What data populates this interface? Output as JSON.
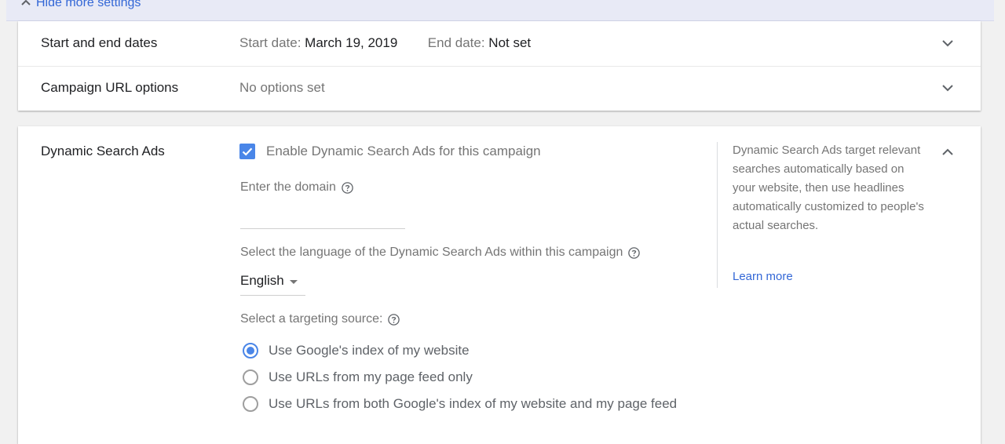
{
  "top_bar": {
    "hide_label": "Hide more settings"
  },
  "settings_rows": [
    {
      "title": "Start and end dates",
      "start_label": "Start date:",
      "start_value": "March 19, 2019",
      "end_label": "End date:",
      "end_value": "Not set"
    },
    {
      "title": "Campaign URL options",
      "summary": "No options set"
    }
  ],
  "dsa": {
    "title": "Dynamic Search Ads",
    "enable_label": "Enable Dynamic Search Ads for this campaign",
    "enable_checked": true,
    "domain_label": "Enter the domain",
    "domain_value": "",
    "language_label": "Select the language of the Dynamic Search Ads within this campaign",
    "language_value": "English",
    "targeting_label": "Select a targeting source:",
    "targeting_options": [
      {
        "label": "Use Google's index of my website",
        "selected": true
      },
      {
        "label": "Use URLs from my page feed only",
        "selected": false
      },
      {
        "label": "Use URLs from both Google's index of my website and my page feed",
        "selected": false
      }
    ],
    "side_text": "Dynamic Search Ads target relevant searches automatically based on your website, then use headlines automatically customized to people's actual searches.",
    "learn_more": "Learn more"
  },
  "icons": {
    "collapse": "chevron-up-icon",
    "expand": "chevron-down-icon",
    "help": "help-circle-icon",
    "check": "check-icon",
    "dropdown": "caret-down-icon"
  },
  "colors": {
    "accent": "#4a86e8",
    "link": "#3367d6",
    "top_bar_bg": "#e8eaf6",
    "page_bg": "#f1f1f1"
  }
}
